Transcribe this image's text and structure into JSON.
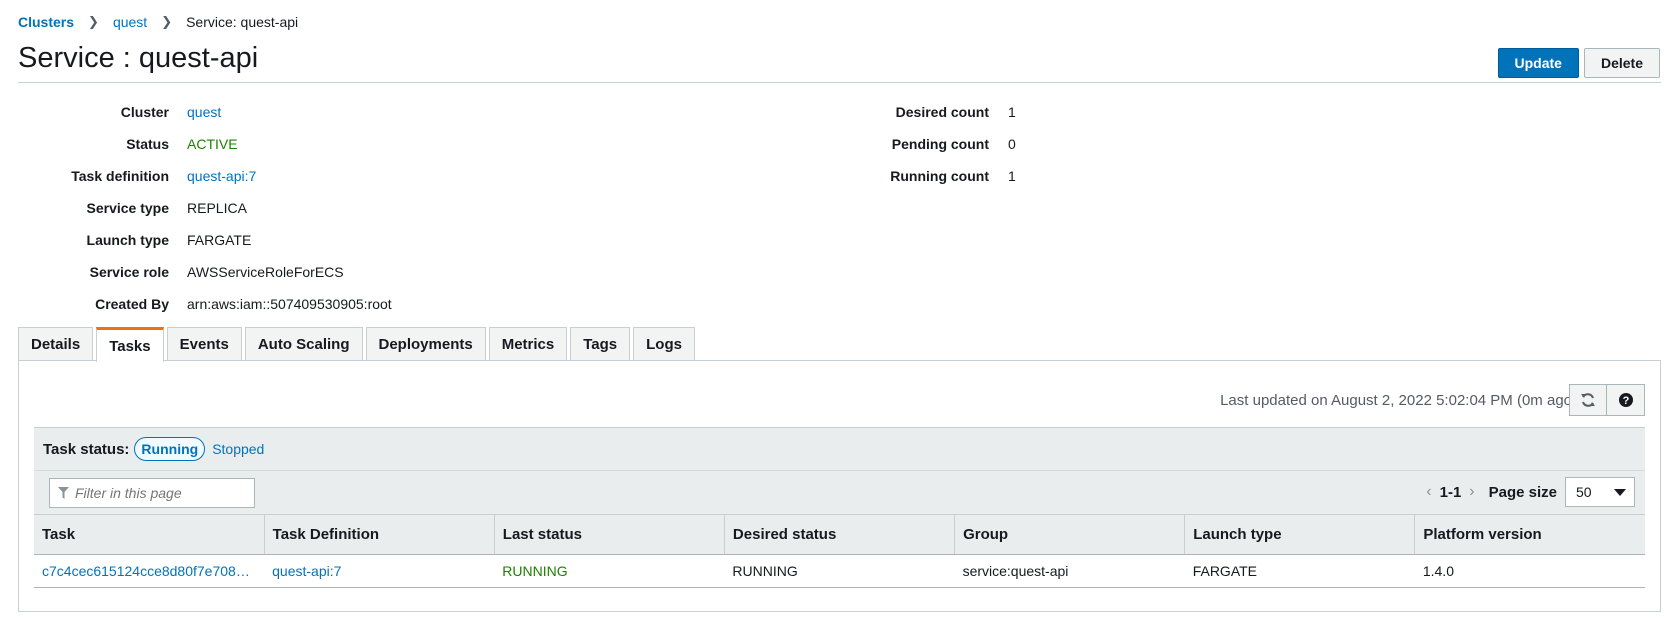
{
  "breadcrumb": {
    "clusters": "Clusters",
    "cluster": "quest",
    "current": "Service: quest-api"
  },
  "header": {
    "title": "Service : quest-api",
    "update_label": "Update",
    "delete_label": "Delete"
  },
  "info_left": [
    {
      "label": "Cluster",
      "value": "quest",
      "kind": "link"
    },
    {
      "label": "Status",
      "value": "ACTIVE",
      "kind": "status"
    },
    {
      "label": "Task definition",
      "value": "quest-api:7",
      "kind": "link"
    },
    {
      "label": "Service type",
      "value": "REPLICA",
      "kind": "text"
    },
    {
      "label": "Launch type",
      "value": "FARGATE",
      "kind": "text"
    },
    {
      "label": "Service role",
      "value": "AWSServiceRoleForECS",
      "kind": "text"
    },
    {
      "label": "Created By",
      "value": "arn:aws:iam::507409530905:root",
      "kind": "text"
    }
  ],
  "info_right": [
    {
      "label": "Desired count",
      "value": "1"
    },
    {
      "label": "Pending count",
      "value": "0"
    },
    {
      "label": "Running count",
      "value": "1"
    }
  ],
  "tabs": [
    "Details",
    "Tasks",
    "Events",
    "Auto Scaling",
    "Deployments",
    "Metrics",
    "Tags",
    "Logs"
  ],
  "active_tab": "Tasks",
  "tasks": {
    "last_updated": "Last updated on August 2, 2022 5:02:04 PM (0m ago)",
    "status_label": "Task status:",
    "running_label": "Running",
    "stopped_label": "Stopped",
    "filter_placeholder": "Filter in this page",
    "page_range": "1-1",
    "page_size_label": "Page size",
    "page_size": "50",
    "columns": [
      "Task",
      "Task Definition",
      "Last status",
      "Desired status",
      "Group",
      "Launch type",
      "Platform version"
    ],
    "rows": [
      [
        "c7c4cec615124cce8d80f7e708…",
        "quest-api:7",
        "RUNNING",
        "RUNNING",
        "service:quest-api",
        "FARGATE",
        "1.4.0"
      ]
    ]
  },
  "colors": {
    "link": "#0073bb",
    "active_status": "#1d8102",
    "primary_button": "#0073bb",
    "tab_accent": "#ec7211"
  }
}
